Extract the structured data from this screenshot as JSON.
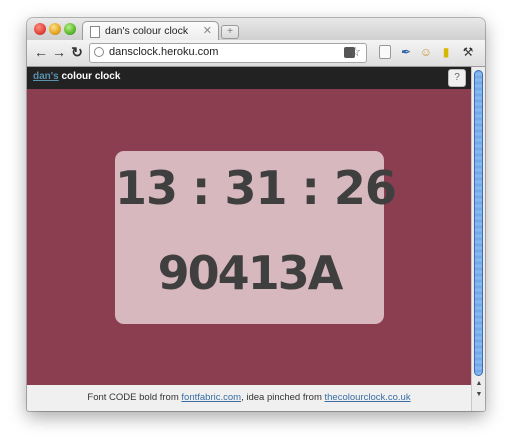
{
  "browser": {
    "tab_title": "dan's colour clock",
    "tab_close": "✕",
    "new_tab": "+",
    "url": "dansclock.heroku.com"
  },
  "toolbar_icons": [
    "back-icon",
    "forward-icon",
    "reload-icon",
    "star-icon",
    "extensions-icon",
    "wrench-icon"
  ],
  "header": {
    "brand_link": "dan's",
    "brand_rest": " colour clock",
    "help_label": "?"
  },
  "clock": {
    "time": "13 : 31 : 26",
    "hex": "90413A",
    "background_color": "#8b3e50"
  },
  "footer": {
    "prefix": "Font CODE bold from ",
    "link1": "fontfabric.com",
    "middle": ", idea pinched from ",
    "link2": "thecolourclock.co.uk"
  }
}
